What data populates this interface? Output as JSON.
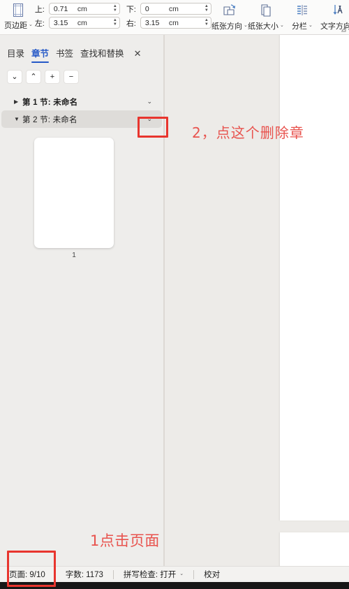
{
  "ribbon": {
    "margins": {
      "label": "页边距",
      "icon": "page-margins-icon",
      "caret": "⌄"
    },
    "fields": [
      {
        "name": "top",
        "label": "上:",
        "value": "0.71",
        "unit": "cm"
      },
      {
        "name": "bottom",
        "label": "下:",
        "value": "0",
        "unit": "cm"
      },
      {
        "name": "left",
        "label": "左:",
        "value": "3.15",
        "unit": "cm"
      },
      {
        "name": "right",
        "label": "右:",
        "value": "3.15",
        "unit": "cm"
      }
    ],
    "buttons": [
      {
        "name": "orientation",
        "label": "纸张方向",
        "icon": "page-orientation-icon",
        "caret": "⌄"
      },
      {
        "name": "size",
        "label": "纸张大小",
        "icon": "page-size-icon",
        "caret": "⌄"
      },
      {
        "name": "columns",
        "label": "分栏",
        "icon": "columns-icon",
        "caret": "⌄"
      },
      {
        "name": "text-direction",
        "label": "文字方向",
        "icon": "text-direction-icon",
        "caret": "⌄"
      }
    ],
    "expander": "⌐"
  },
  "sidebar": {
    "tabs": [
      {
        "label": "目录",
        "active": false
      },
      {
        "label": "章节",
        "active": true
      },
      {
        "label": "书签",
        "active": false
      },
      {
        "label": "查找和替换",
        "active": false
      }
    ],
    "close_label": "✕",
    "toolbar": [
      {
        "name": "move-down",
        "glyph": "⌄"
      },
      {
        "name": "move-up",
        "glyph": "⌃"
      },
      {
        "name": "add",
        "glyph": "+"
      },
      {
        "name": "remove",
        "glyph": "−"
      }
    ],
    "sections": [
      {
        "label": "第 1 节: 未命名",
        "triangle": "▶",
        "chevron": "⌄",
        "selected": false
      },
      {
        "label": "第 2 节: 未命名",
        "triangle": "▼",
        "chevron": "⌄",
        "selected": true
      }
    ],
    "thumbnail": {
      "page_number": "1"
    }
  },
  "statusbar": {
    "page": "页面: 9/10",
    "words": "字数: 1173",
    "spellcheck": "拼写检查: 打开",
    "spellcheck_caret": "⌄",
    "proofread": "校对"
  },
  "annotations": {
    "step1": "1点击页面",
    "step2": "2，点这个删除章",
    "color": "#e8352e"
  }
}
